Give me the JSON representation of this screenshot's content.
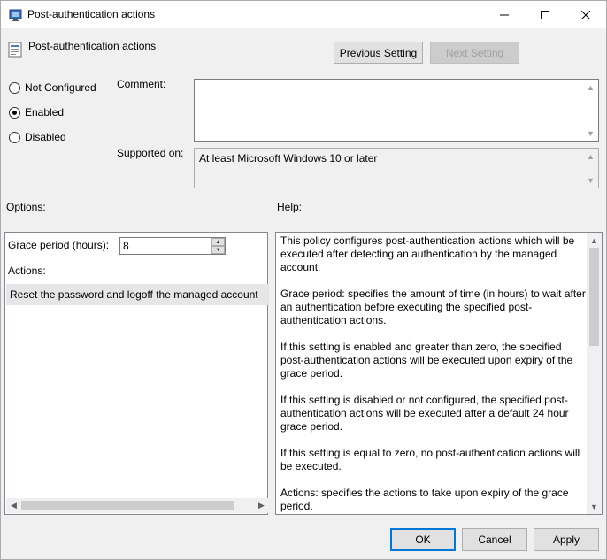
{
  "window": {
    "title": "Post-authentication actions",
    "controls": {
      "minimize": "minimize-icon",
      "maximize": "maximize-icon",
      "close": "close-icon"
    }
  },
  "header": {
    "title": "Post-authentication actions",
    "previous_label": "Previous Setting",
    "next_label": "Next Setting"
  },
  "state": {
    "not_configured": "Not Configured",
    "enabled": "Enabled",
    "disabled": "Disabled",
    "selected": "Enabled"
  },
  "comment": {
    "label": "Comment:",
    "value": ""
  },
  "supported": {
    "label": "Supported on:",
    "value": "At least Microsoft Windows 10 or later"
  },
  "options": {
    "label": "Options:",
    "grace_label": "Grace period (hours):",
    "grace_value": "8",
    "actions_label": "Actions:",
    "action_selected": "Reset the password and logoff the managed account"
  },
  "help": {
    "label": "Help:",
    "paragraphs": [
      "This policy configures post-authentication actions which will be executed after detecting an authentication by the managed account.",
      "Grace period: specifies the amount of time (in hours) to wait after an authentication before executing the specified post-authentication actions.",
      "If this setting is enabled and greater than zero, the specified post-authentication actions will be executed upon expiry of the grace period.",
      "If this setting is disabled or not configured, the specified post-authentication actions will be executed after a default 24 hour grace period.",
      "If this setting is equal to zero, no post-authentication actions will be executed.",
      "Actions: specifies the actions to take upon expiry of the grace period."
    ]
  },
  "footer": {
    "ok_label": "OK",
    "cancel_label": "Cancel",
    "apply_label": "Apply"
  },
  "colors": {
    "accent": "#0078d7",
    "dialog_bg": "#f0f0f0"
  }
}
